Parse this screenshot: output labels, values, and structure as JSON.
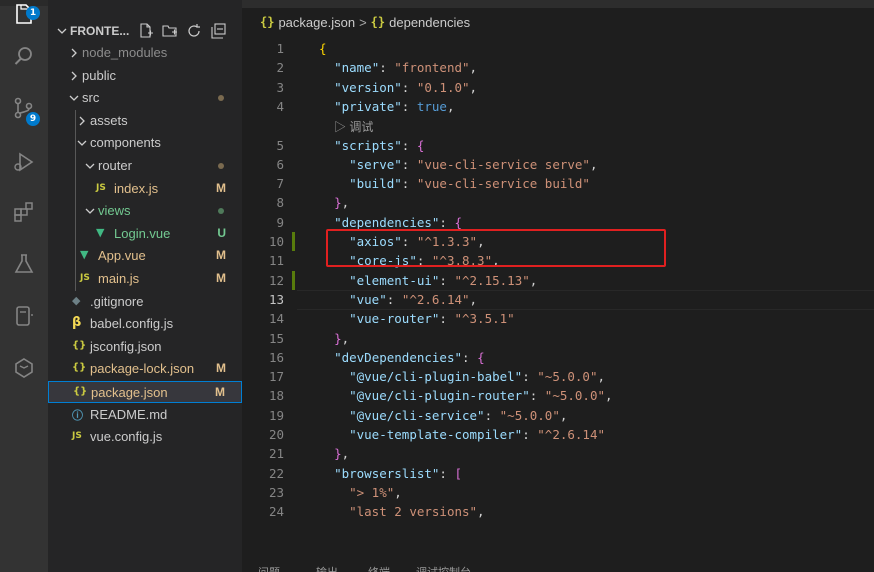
{
  "activity_bar": {
    "icons": [
      "explorer-icon",
      "search-icon",
      "source-control-icon",
      "run-debug-icon",
      "extensions-icon",
      "testing-icon",
      "remote-explorer-icon",
      "package-icon"
    ],
    "explorer_badge": "1",
    "scm_badge": "9"
  },
  "explorer": {
    "title": "FRONTE...",
    "items": [
      {
        "label": "node_modules",
        "kind": "folder",
        "expanded": false,
        "status": "",
        "color": "#8c8c8c"
      },
      {
        "label": "public",
        "kind": "folder",
        "expanded": false,
        "status": "",
        "color": "#cccccc"
      },
      {
        "label": "src",
        "kind": "folder",
        "expanded": true,
        "status": "dot",
        "color": "#cccccc"
      },
      {
        "label": "assets",
        "kind": "folder",
        "expanded": false,
        "status": "",
        "color": "#cccccc"
      },
      {
        "label": "components",
        "kind": "folder",
        "expanded": true,
        "status": "",
        "color": "#cccccc"
      },
      {
        "label": "router",
        "kind": "folder",
        "expanded": true,
        "status": "dot",
        "color": "#cccccc"
      },
      {
        "label": "index.js",
        "kind": "js",
        "status": "M",
        "color": "#e2c08d"
      },
      {
        "label": "views",
        "kind": "folder",
        "expanded": true,
        "status": "dot-green",
        "color": "#73c991"
      },
      {
        "label": "Login.vue",
        "kind": "vue",
        "status": "U",
        "color": "#73c991"
      },
      {
        "label": "App.vue",
        "kind": "vue",
        "status": "M",
        "color": "#e2c08d"
      },
      {
        "label": "main.js",
        "kind": "js",
        "status": "M",
        "color": "#e2c08d"
      },
      {
        "label": ".gitignore",
        "kind": "git",
        "status": "",
        "color": "#cccccc"
      },
      {
        "label": "babel.config.js",
        "kind": "babel",
        "status": "",
        "color": "#cccccc"
      },
      {
        "label": "jsconfig.json",
        "kind": "json",
        "status": "",
        "color": "#cccccc"
      },
      {
        "label": "package-lock.json",
        "kind": "json",
        "status": "M",
        "color": "#e2c08d"
      },
      {
        "label": "package.json",
        "kind": "json",
        "status": "M",
        "color": "#e2c08d",
        "selected": true
      },
      {
        "label": "README.md",
        "kind": "info",
        "status": "",
        "color": "#cccccc"
      },
      {
        "label": "vue.config.js",
        "kind": "js",
        "status": "",
        "color": "#cccccc"
      }
    ]
  },
  "breadcrumb": {
    "file_icon": "{}",
    "file": "package.json",
    "separator": ">",
    "symbol_icon": "{}",
    "symbol": "dependencies"
  },
  "codelens": "▷ 调试",
  "active_line": 13,
  "modified_lines": [
    10,
    12
  ],
  "code_lines": [
    {
      "n": 1,
      "tokens": [
        [
          "p1",
          "{"
        ]
      ]
    },
    {
      "n": 2,
      "tokens": [
        [
          "w",
          "  "
        ],
        [
          "k",
          "\"name\""
        ],
        [
          "w",
          ": "
        ],
        [
          "s",
          "\"frontend\""
        ],
        [
          "w",
          ","
        ]
      ]
    },
    {
      "n": 3,
      "tokens": [
        [
          "w",
          "  "
        ],
        [
          "k",
          "\"version\""
        ],
        [
          "w",
          ": "
        ],
        [
          "s",
          "\"0.1.0\""
        ],
        [
          "w",
          ","
        ]
      ]
    },
    {
      "n": 4,
      "tokens": [
        [
          "w",
          "  "
        ],
        [
          "k",
          "\"private\""
        ],
        [
          "w",
          ": "
        ],
        [
          "b",
          "true"
        ],
        [
          "w",
          ","
        ]
      ]
    },
    {
      "n": 5,
      "tokens": [
        [
          "w",
          "  "
        ],
        [
          "k",
          "\"scripts\""
        ],
        [
          "w",
          ": "
        ],
        [
          "p2",
          "{"
        ]
      ]
    },
    {
      "n": 6,
      "tokens": [
        [
          "w",
          "    "
        ],
        [
          "k",
          "\"serve\""
        ],
        [
          "w",
          ": "
        ],
        [
          "s",
          "\"vue-cli-service serve\""
        ],
        [
          "w",
          ","
        ]
      ]
    },
    {
      "n": 7,
      "tokens": [
        [
          "w",
          "    "
        ],
        [
          "k",
          "\"build\""
        ],
        [
          "w",
          ": "
        ],
        [
          "s",
          "\"vue-cli-service build\""
        ]
      ]
    },
    {
      "n": 8,
      "tokens": [
        [
          "w",
          "  "
        ],
        [
          "p2",
          "}"
        ],
        [
          "w",
          ","
        ]
      ]
    },
    {
      "n": 9,
      "tokens": [
        [
          "w",
          "  "
        ],
        [
          "k",
          "\"dependencies\""
        ],
        [
          "w",
          ": "
        ],
        [
          "p2",
          "{"
        ]
      ]
    },
    {
      "n": 10,
      "tokens": [
        [
          "w",
          "    "
        ],
        [
          "k",
          "\"axios\""
        ],
        [
          "w",
          ": "
        ],
        [
          "s",
          "\"^1.3.3\""
        ],
        [
          "w",
          ","
        ]
      ]
    },
    {
      "n": 11,
      "tokens": [
        [
          "w",
          "    "
        ],
        [
          "k",
          "\"core-js\""
        ],
        [
          "w",
          ": "
        ],
        [
          "s",
          "\"^3.8.3\""
        ],
        [
          "w",
          ","
        ]
      ]
    },
    {
      "n": 12,
      "tokens": [
        [
          "w",
          "    "
        ],
        [
          "k",
          "\"element-ui\""
        ],
        [
          "w",
          ": "
        ],
        [
          "s",
          "\"^2.15.13\""
        ],
        [
          "w",
          ","
        ]
      ]
    },
    {
      "n": 13,
      "tokens": [
        [
          "w",
          "    "
        ],
        [
          "k",
          "\"vue\""
        ],
        [
          "w",
          ": "
        ],
        [
          "s",
          "\"^2.6.14\""
        ],
        [
          "w",
          ","
        ]
      ]
    },
    {
      "n": 14,
      "tokens": [
        [
          "w",
          "    "
        ],
        [
          "k",
          "\"vue-router\""
        ],
        [
          "w",
          ": "
        ],
        [
          "s",
          "\"^3.5.1\""
        ]
      ]
    },
    {
      "n": 15,
      "tokens": [
        [
          "w",
          "  "
        ],
        [
          "p2",
          "}"
        ],
        [
          "w",
          ","
        ]
      ]
    },
    {
      "n": 16,
      "tokens": [
        [
          "w",
          "  "
        ],
        [
          "k",
          "\"devDependencies\""
        ],
        [
          "w",
          ": "
        ],
        [
          "p2",
          "{"
        ]
      ]
    },
    {
      "n": 17,
      "tokens": [
        [
          "w",
          "    "
        ],
        [
          "k",
          "\"@vue/cli-plugin-babel\""
        ],
        [
          "w",
          ": "
        ],
        [
          "s",
          "\"~5.0.0\""
        ],
        [
          "w",
          ","
        ]
      ]
    },
    {
      "n": 18,
      "tokens": [
        [
          "w",
          "    "
        ],
        [
          "k",
          "\"@vue/cli-plugin-router\""
        ],
        [
          "w",
          ": "
        ],
        [
          "s",
          "\"~5.0.0\""
        ],
        [
          "w",
          ","
        ]
      ]
    },
    {
      "n": 19,
      "tokens": [
        [
          "w",
          "    "
        ],
        [
          "k",
          "\"@vue/cli-service\""
        ],
        [
          "w",
          ": "
        ],
        [
          "s",
          "\"~5.0.0\""
        ],
        [
          "w",
          ","
        ]
      ]
    },
    {
      "n": 20,
      "tokens": [
        [
          "w",
          "    "
        ],
        [
          "k",
          "\"vue-template-compiler\""
        ],
        [
          "w",
          ": "
        ],
        [
          "s",
          "\"^2.6.14\""
        ]
      ]
    },
    {
      "n": 21,
      "tokens": [
        [
          "w",
          "  "
        ],
        [
          "p2",
          "}"
        ],
        [
          "w",
          ","
        ]
      ]
    },
    {
      "n": 22,
      "tokens": [
        [
          "w",
          "  "
        ],
        [
          "k",
          "\"browserslist\""
        ],
        [
          "w",
          ": "
        ],
        [
          "p2",
          "["
        ]
      ]
    },
    {
      "n": 23,
      "tokens": [
        [
          "w",
          "    "
        ],
        [
          "s",
          "\"> 1%\""
        ],
        [
          "w",
          ","
        ]
      ]
    },
    {
      "n": 24,
      "tokens": [
        [
          "w",
          "    "
        ],
        [
          "s",
          "\"last 2 versions\""
        ],
        [
          "w",
          ","
        ]
      ]
    }
  ],
  "panel_tabs": [
    "问题",
    "输出",
    "终端",
    "调试控制台"
  ],
  "colors": {
    "accent": "#007acc",
    "highlight_box": "#e02020",
    "modified": "#e2c08d",
    "untracked": "#73c991"
  }
}
